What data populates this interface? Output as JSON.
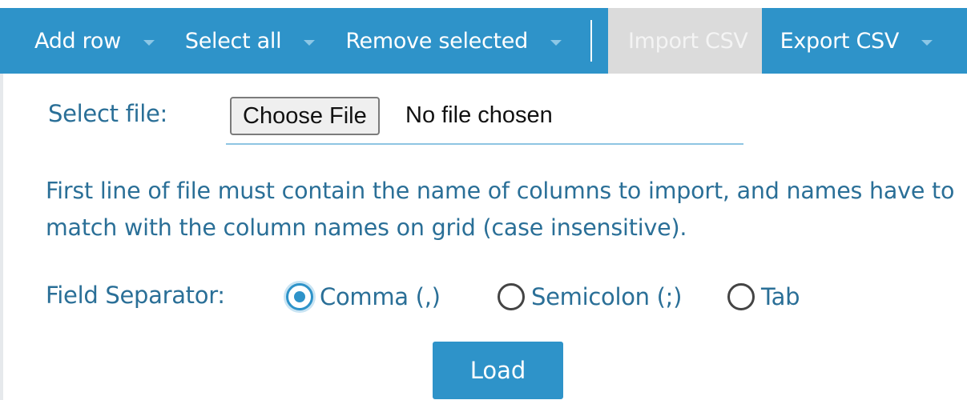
{
  "toolbar": {
    "add_row": "Add row",
    "select_all": "Select all",
    "remove_selected": "Remove selected",
    "import_csv": "Import CSV",
    "export_csv": "Export CSV"
  },
  "form": {
    "select_file_label": "Select file:",
    "choose_file_button": "Choose File",
    "file_status": "No file chosen",
    "hint": "First line of file must contain the name of columns to import, and names have to match with the column names on grid (case insensitive).",
    "separator_label": "Field Separator:",
    "separators": [
      {
        "label": "Comma (,)",
        "checked": true
      },
      {
        "label": "Semicolon (;)",
        "checked": false
      },
      {
        "label": "Tab",
        "checked": false
      }
    ],
    "load_button": "Load"
  },
  "colors": {
    "accent": "#2e93c9",
    "text": "#2a6f97",
    "active_tab_bg": "#dbdbdb"
  }
}
